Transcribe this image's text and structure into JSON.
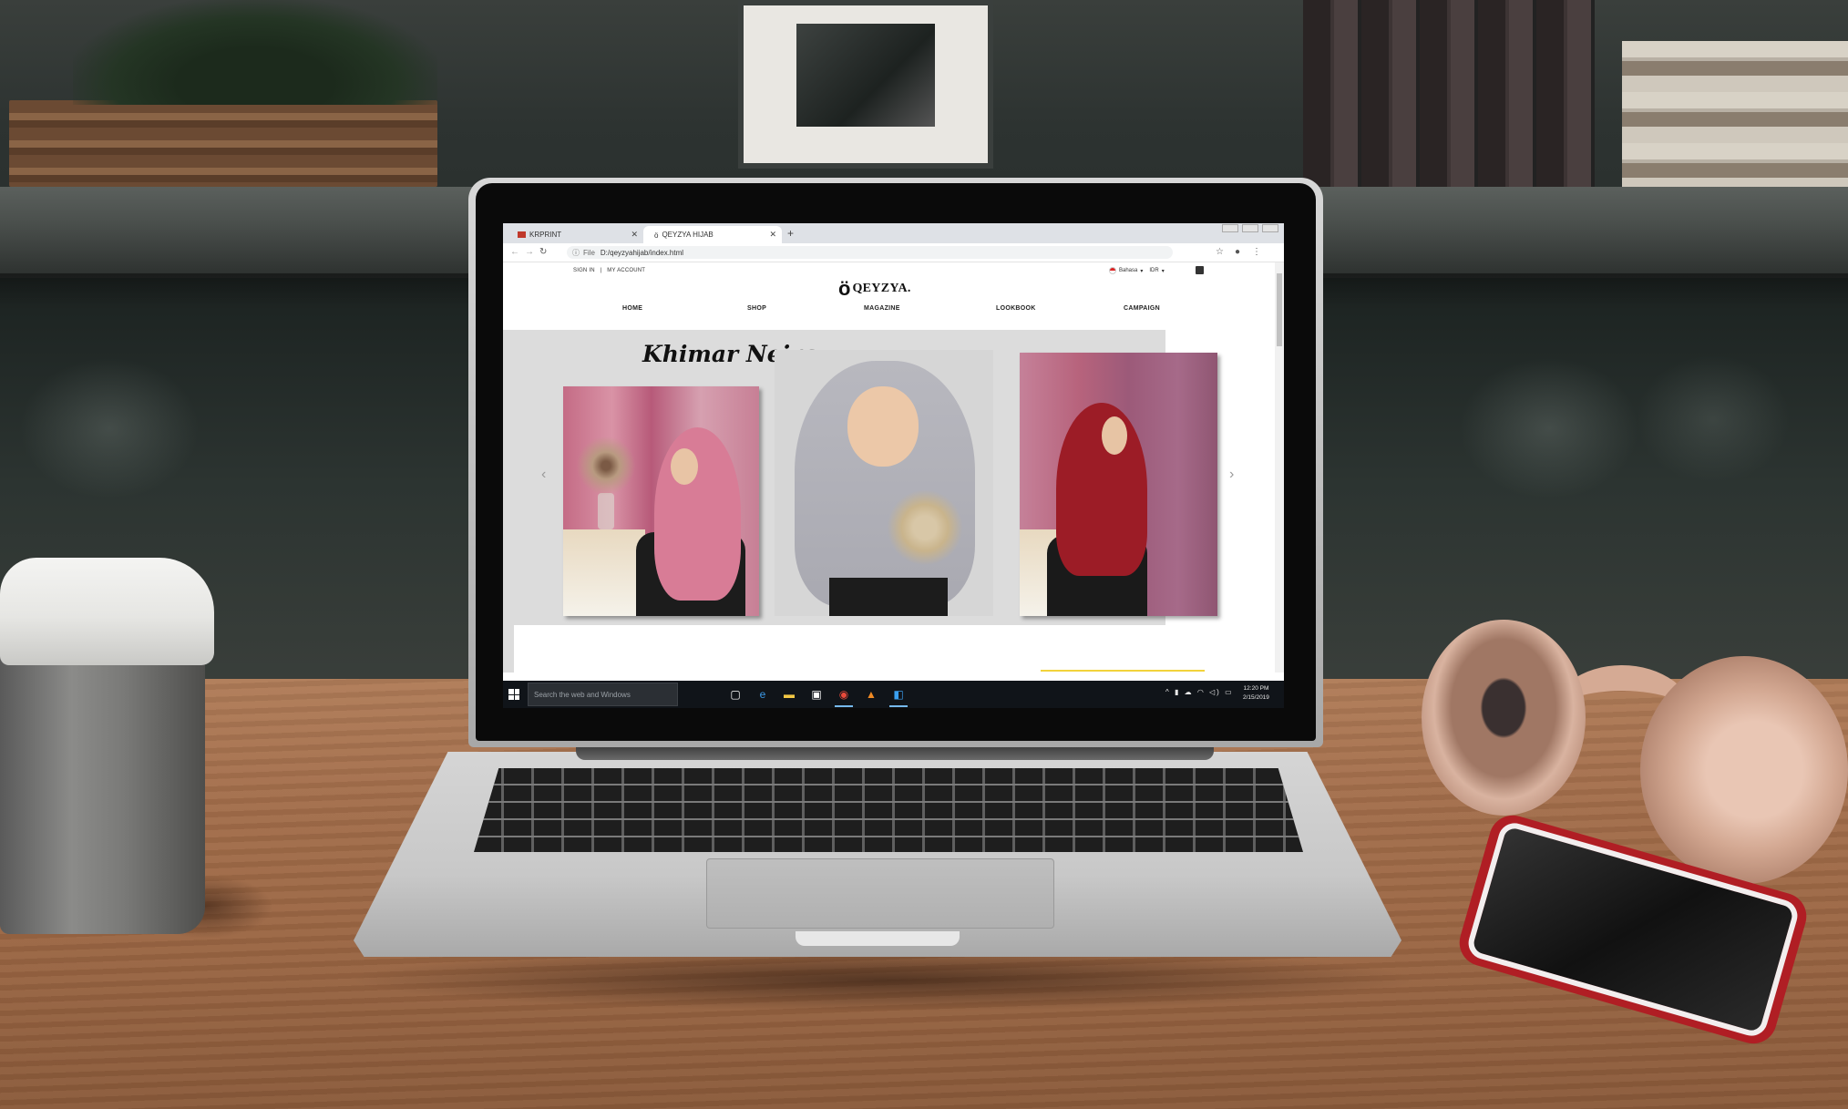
{
  "browser": {
    "tabs": [
      {
        "label": "KRPRINT"
      },
      {
        "label": "QEYZYA HIJAB"
      }
    ],
    "new_tab": "+",
    "address": {
      "protocol": "File",
      "url": "D:/qeyzyahijab/index.html"
    }
  },
  "site": {
    "top_links": {
      "sign_in": "SIGN IN",
      "separator": "|",
      "my_account": "MY ACCOUNT"
    },
    "language": "Bahasa",
    "currency": "IDR",
    "logo_text": "QEYZYA.",
    "nav": [
      "HOME",
      "SHOP",
      "MAGAZINE",
      "LOOKBOOK",
      "CAMPAIGN"
    ],
    "hero": {
      "title": "Khimar Neira",
      "prev_arrow": "‹",
      "next_arrow": "›"
    }
  },
  "taskbar": {
    "search_placeholder": "Search the web and Windows",
    "time": "12:20 PM",
    "date": "2/15/2019"
  },
  "colors": {
    "hero_bg": "#dcdcdc",
    "accent_yellow": "#f2d33b",
    "taskbar": "#101419"
  },
  "icons": [
    "windows-start-icon",
    "task-view-icon",
    "edge-icon",
    "file-explorer-icon",
    "store-icon",
    "chrome-icon",
    "vlc-icon",
    "vscode-icon",
    "cart-icon",
    "star-icon",
    "profile-icon",
    "menu-icon"
  ]
}
